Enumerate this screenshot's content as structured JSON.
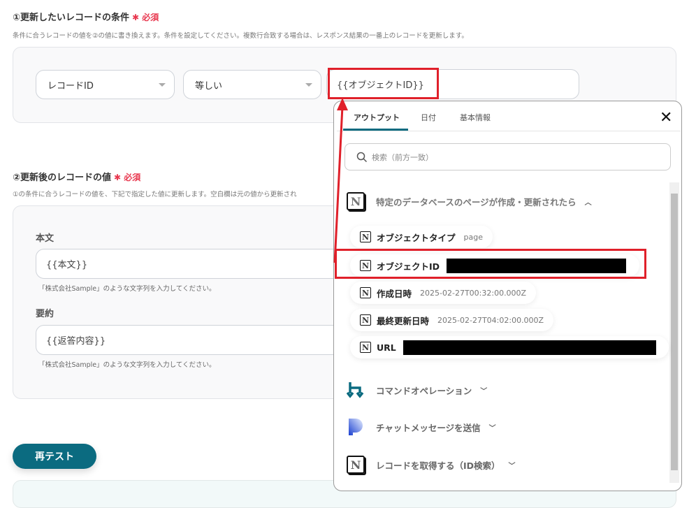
{
  "section1": {
    "title": "①更新したいレコードの条件",
    "required": "必須",
    "description": "条件に合うレコードの値を②の値に書き換えます。条件を設定してください。複数行合致する場合は、レスポンス結果の一番上のレコードを更新します。",
    "field_select": "レコードID",
    "operator_select": "等しい",
    "value_input": "{{オブジェクトID}}"
  },
  "section2": {
    "title": "②更新後のレコードの値",
    "required": "必須",
    "description": "①の条件に合うレコードの値を、下記で指定した値に更新します。空白欄は元の値から更新され",
    "fields": [
      {
        "label": "本文",
        "value": "{{本文}}",
        "hint": "「株式会社Sample」のような文字列を入力してください。"
      },
      {
        "label": "要約",
        "value": "{{返答内容}}",
        "hint": "「株式会社Sample」のような文字列を入力してください。"
      }
    ]
  },
  "retest_button": "再テスト",
  "popup": {
    "tabs": [
      "アウトプット",
      "日付",
      "基本情報"
    ],
    "search_placeholder": "検索（前方一致）",
    "group_title": "特定のデータベースのページが作成・更新されたら",
    "items": [
      {
        "label": "オブジェクトタイプ",
        "value": "page"
      },
      {
        "label": "オブジェクトID",
        "value": ""
      },
      {
        "label": "作成日時",
        "value": "2025-02-27T00:32:00.000Z"
      },
      {
        "label": "最終更新日時",
        "value": "2025-02-27T04:02:00.000Z"
      },
      {
        "label": "URL",
        "value": ""
      }
    ],
    "groups": [
      "コマンドオペレーション",
      "チャットメッセージを送信",
      "レコードを取得する（ID検索）"
    ]
  },
  "colors": {
    "accent": "#0b6b80",
    "highlight": "#e0202a",
    "required": "#e8384f"
  }
}
